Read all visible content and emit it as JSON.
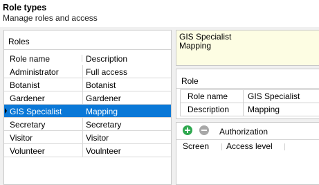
{
  "header": {
    "title": "Role types",
    "subtitle": "Manage roles and access"
  },
  "roles": {
    "panel_title": "Roles",
    "columns": [
      "Role name",
      "Description"
    ],
    "rows": [
      {
        "name": "Administrator",
        "description": "Full access"
      },
      {
        "name": "Botanist",
        "description": "Botanist"
      },
      {
        "name": "Gardener",
        "description": "Gardener"
      },
      {
        "name": "GIS Specialist",
        "description": "Mapping"
      },
      {
        "name": "Secretary",
        "description": "Secretary"
      },
      {
        "name": "Visitor",
        "description": "Visitor"
      },
      {
        "name": "Volunteer",
        "description": "Voulnteer"
      }
    ],
    "selected_index": 3
  },
  "note": {
    "line1": "GIS Specialist",
    "line2": "Mapping"
  },
  "role_detail": {
    "panel_title": "Role",
    "fields": [
      {
        "label": "Role name",
        "value": "GIS Specialist"
      },
      {
        "label": "Description",
        "value": "Mapping"
      }
    ]
  },
  "authorization": {
    "panel_title": "Authorization",
    "add_icon": "plus-circle-icon",
    "remove_icon": "minus-circle-icon",
    "columns": [
      "Screen",
      "Access level"
    ]
  },
  "colors": {
    "selection": "#0a78d7",
    "note_background": "#fdfde3",
    "add_button": "#2fa84f",
    "remove_button": "#a8a8a8"
  }
}
